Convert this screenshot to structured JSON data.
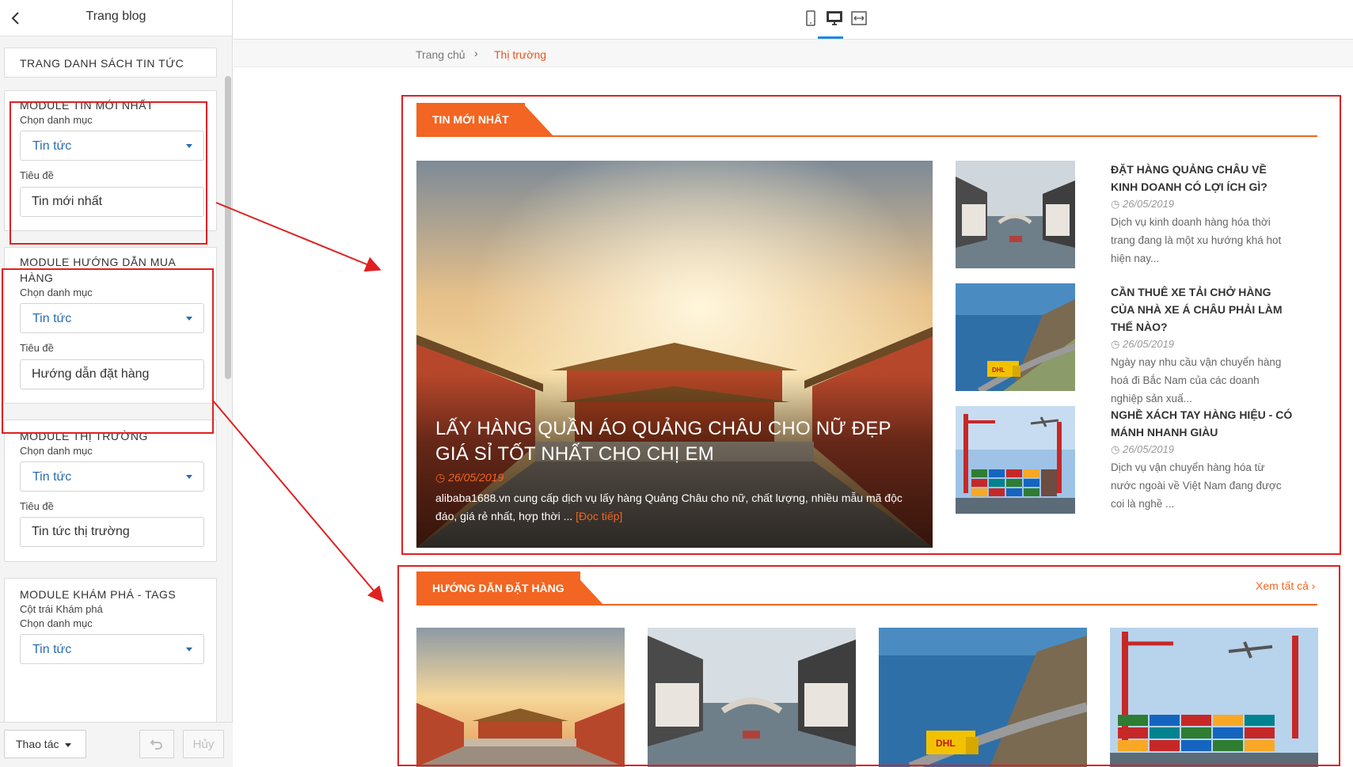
{
  "sidebar": {
    "title": "Trang blog",
    "page_list_label": "TRANG DANH SÁCH TIN TỨC",
    "modules": [
      {
        "title": "MODULE TIN MỚI NHẤT",
        "extra": "",
        "category_label": "Chọn danh mục",
        "category_value": "Tin tức",
        "title_label": "Tiêu đề",
        "title_value": "Tin mới nhất"
      },
      {
        "title": "MODULE HƯỚNG DẪN MUA HÀNG",
        "extra": "",
        "category_label": "Chọn danh mục",
        "category_value": "Tin tức",
        "title_label": "Tiêu đề",
        "title_value": "Hướng dẫn đặt hàng"
      },
      {
        "title": "MODULE THỊ TRƯỜNG",
        "extra": "",
        "category_label": "Chọn danh mục",
        "category_value": "Tin tức",
        "title_label": "Tiêu đề",
        "title_value": "Tin tức thị trường"
      },
      {
        "title": "MODULE KHÁM PHÁ - TAGS",
        "extra": "Cột trái Khám phá",
        "category_label": "Chọn danh mục",
        "category_value": "Tin tức",
        "title_label": "",
        "title_value": ""
      }
    ],
    "footer": {
      "actions_label": "Thao tác",
      "cancel_label": "Hủy"
    }
  },
  "toolbar": {
    "icons": [
      "mobile-icon",
      "desktop-icon",
      "fullwidth-icon"
    ],
    "active": "desktop-icon",
    "active_color": "#1e88e5"
  },
  "breadcrumb": {
    "home": "Trang chủ",
    "current": "Thị trường"
  },
  "latest": {
    "tab_label": "TIN MỚI NHẤT",
    "hero": {
      "title": "LẤY HÀNG QUẦN ÁO QUẢNG CHÂU CHO NỮ ĐẸP GIÁ SỈ TỐT NHẤT CHO CHỊ EM",
      "date": "26/05/2019",
      "desc": "alibaba1688.vn cung cấp dịch vụ lấy hàng Quảng Châu cho nữ, chất lượng, nhiều mẫu mã độc đáo, giá rẻ nhất, hợp thời ...",
      "more": "[Đọc tiếp]"
    },
    "items": [
      {
        "title": "ĐẶT HÀNG QUẢNG CHÂU VỀ KINH DOANH CÓ LỢI ÍCH GÌ?",
        "date": "26/05/2019",
        "summary": "Dịch vụ kinh doanh hàng hóa thời trang đang là một xu hướng khá hot hiện nay..."
      },
      {
        "title": "CẦN THUÊ XE TẢI CHỞ HÀNG CỦA NHÀ XE Á CHÂU PHẢI LÀM THẾ NÀO?",
        "date": "26/05/2019",
        "summary": "Ngày nay nhu cầu vận chuyển hàng hoá đi Bắc Nam của các doanh nghiệp sản xuấ..."
      },
      {
        "title": "NGHỀ XÁCH TAY HÀNG HIỆU - CÓ MÁNH NHANH GIÀU",
        "date": "26/05/2019",
        "summary": "Dịch vụ vận chuyển hàng hóa từ nước ngoài về Việt Nam đang được coi là nghề ..."
      }
    ]
  },
  "guide": {
    "tab_label": "HƯỚNG DẪN ĐẶT HÀNG",
    "view_all": "Xem tất cả ›"
  },
  "colors": {
    "accent": "#f26522",
    "annotation": "#e02020",
    "link": "#2b6cb0"
  }
}
